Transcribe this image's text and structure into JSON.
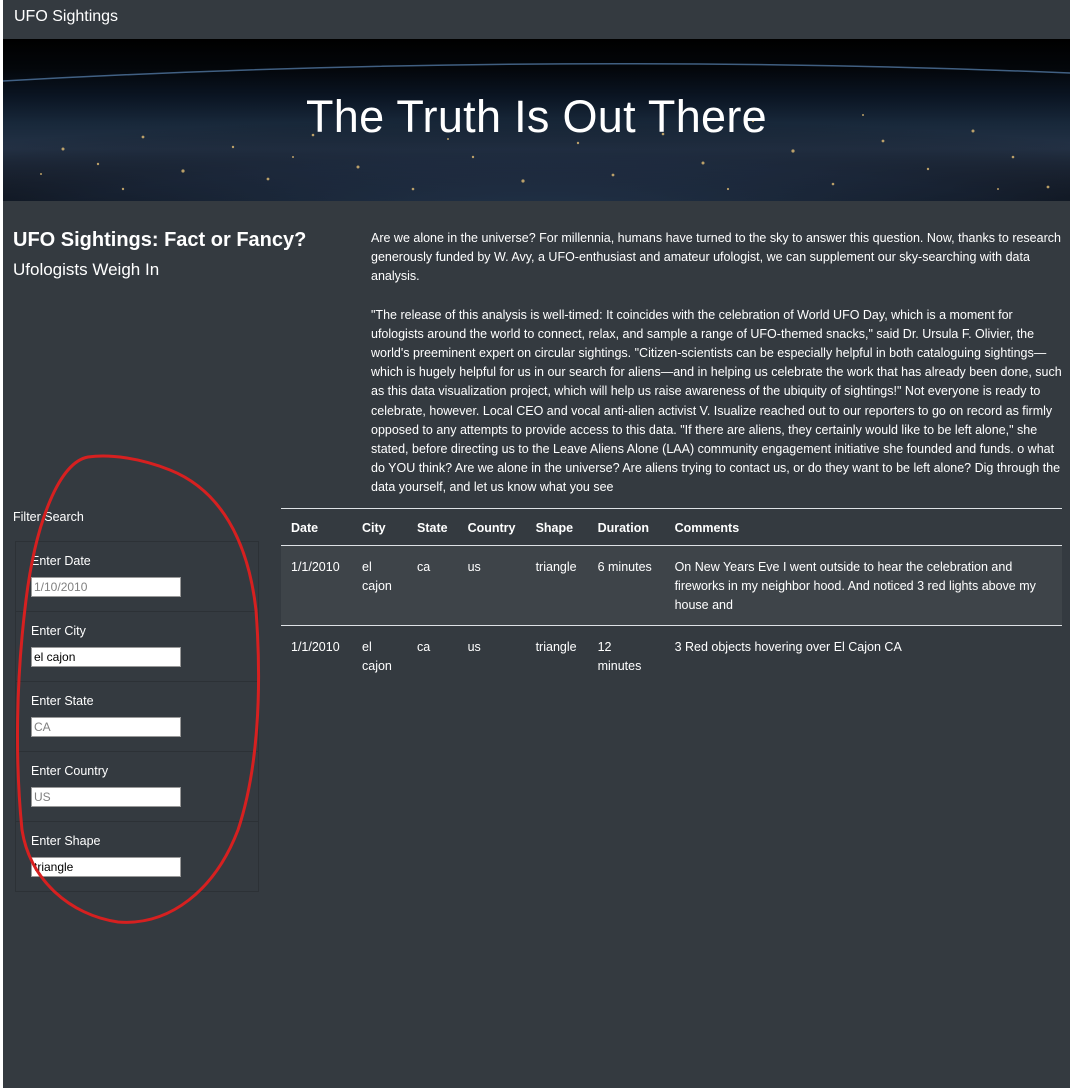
{
  "navbar": {
    "brand": "UFO Sightings"
  },
  "hero": {
    "title": "The Truth Is Out There"
  },
  "intro": {
    "headline": "UFO Sightings: Fact or Fancy?",
    "subheadline": "Ufologists Weigh In",
    "paragraphs": [
      "Are we alone in the universe? For millennia, humans have turned to the sky to answer this question. Now, thanks to research generously funded by W. Avy, a UFO-enthusiast and amateur ufologist, we can supplement our sky-searching with data analysis.",
      "\"The release of this analysis is well-timed: It coincides with the celebration of World UFO Day, which is a moment for ufologists around the world to connect, relax, and sample a range of UFO-themed snacks,\" said Dr. Ursula F. Olivier, the world's preeminent expert on circular sightings. \"Citizen-scientists can be especially helpful in both cataloguing sightings—which is hugely helpful for us in our search for aliens—and in helping us celebrate the work that has already been done, such as this data visualization project, which will help us raise awareness of the ubiquity of sightings!\" Not everyone is ready to celebrate, however. Local CEO and vocal anti-alien activist V. Isualize reached out to our reporters to go on record as firmly opposed to any attempts to provide access to this data. \"If there are aliens, they certainly would like to be left alone,\" she stated, before directing us to the Leave Aliens Alone (LAA) community engagement initiative she founded and funds. o what do YOU think? Are we alone in the universe? Are aliens trying to contact us, or do they want to be left alone? Dig through the data yourself, and let us know what you see"
    ]
  },
  "filters": {
    "title": "Filter Search",
    "date": {
      "label": "Enter Date",
      "value": "",
      "placeholder": "1/10/2010"
    },
    "city": {
      "label": "Enter City",
      "value": "el cajon",
      "placeholder": ""
    },
    "state": {
      "label": "Enter State",
      "value": "",
      "placeholder": "CA"
    },
    "country": {
      "label": "Enter Country",
      "value": "",
      "placeholder": "US"
    },
    "shape": {
      "label": "Enter Shape",
      "value": "triangle",
      "placeholder": ""
    }
  },
  "table": {
    "headers": [
      "Date",
      "City",
      "State",
      "Country",
      "Shape",
      "Duration",
      "Comments"
    ],
    "rows": [
      [
        "1/1/2010",
        "el cajon",
        "ca",
        "us",
        "triangle",
        "6 minutes",
        "On New Years Eve I went outside to hear the celebration and fireworks in my neighbor hood. And noticed 3 red lights above my house and"
      ],
      [
        "1/1/2010",
        "el cajon",
        "ca",
        "us",
        "triangle",
        "12 minutes",
        "3 Red objects hovering over El Cajon CA"
      ]
    ]
  },
  "colors": {
    "page_bg": "#343a40",
    "annotation": "#d62020",
    "row_border": "#dee2e6"
  }
}
